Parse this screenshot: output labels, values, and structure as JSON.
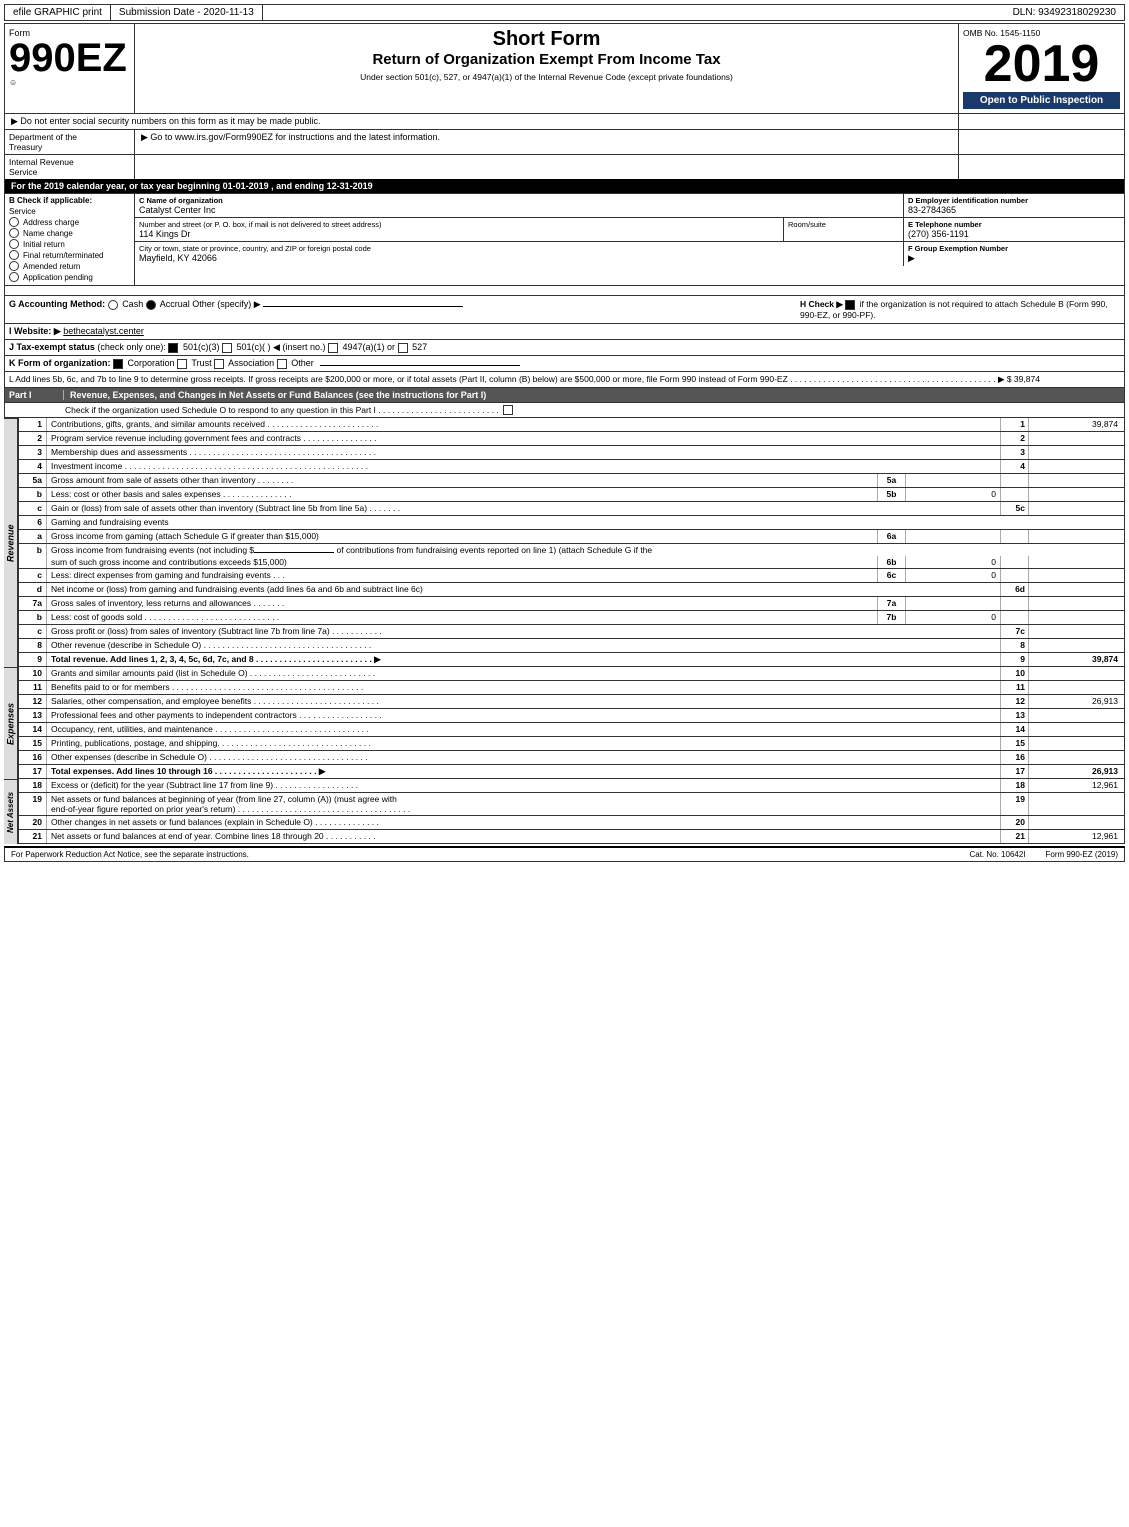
{
  "topBar": {
    "left": "efile GRAPHIC print",
    "mid": "Submission Date - 2020-11-13",
    "right": "DLN: 93492318029230"
  },
  "form": {
    "number": "990EZ",
    "numberSub": "Form",
    "shortFormLabel": "Short Form",
    "returnTitle": "Return of Organization Exempt From Income Tax",
    "subtitle": "Under section 501(c), 527, or 4947(a)(1) of the Internal Revenue Code (except private foundations)",
    "doNotEnter": "▶ Do not enter social security numbers on this form as it may be made public.",
    "goTo": "▶ Go to www.irs.gov/Form990EZ for instructions and the latest information.",
    "ombNo": "OMB No. 1545-1150",
    "year": "2019",
    "openToPublic": "Open to Public Inspection"
  },
  "dept": {
    "line1": "Department of the",
    "line2": "Treasury",
    "line3": "Internal Revenue",
    "line4": "Service"
  },
  "taxYear": {
    "text": "For the 2019 calendar year, or tax year beginning 01-01-2019 , and ending 12-31-2019"
  },
  "checkApplicable": {
    "label": "B Check if applicable:",
    "items": [
      "Address change",
      "Name change",
      "Initial return",
      "Final return/terminated",
      "Amended return",
      "Application pending"
    ]
  },
  "org": {
    "cLabel": "C Name of organization",
    "cValue": "Catalyst Center Inc",
    "dLabel": "D Employer identification number",
    "dValue": "83-2784365",
    "streetLabel": "Number and street (or P. O. box, if mail is not delivered to street address)",
    "streetValue": "114 Kings Dr",
    "roomLabel": "Room/suite",
    "roomValue": "",
    "phoneLabel": "E Telephone number",
    "phoneValue": "(270) 356-1191",
    "cityLabel": "City or town, state or province, country, and ZIP or foreign postal code",
    "cityValue": "Mayfield, KY  42066",
    "groupLabel": "F Group Exemption Number",
    "groupValue": "▶"
  },
  "accounting": {
    "gLabel": "G Accounting Method:",
    "cash": "Cash",
    "accrual": "Accrual",
    "other": "Other (specify) ▶",
    "accrualChecked": true,
    "hLabel": "H Check ▶",
    "hText": "if the organization is not required to attach Schedule B (Form 990, 990-EZ, or 990-PF).",
    "hChecked": true
  },
  "website": {
    "label": "I Website: ▶",
    "value": "bethecatalyst.center"
  },
  "taxStatus": {
    "label": "J Tax-exempt status (check only one):",
    "options": [
      "501(c)(3)",
      "501(c)(  )",
      "(insert no.)",
      "4947(a)(1) or",
      "527"
    ],
    "checked": "501(c)(3)"
  },
  "formOrg": {
    "label": "K Form of organization:",
    "options": [
      "Corporation",
      "Trust",
      "Association",
      "Other"
    ],
    "checked": "Corporation"
  },
  "lineL": {
    "text": "L Add lines 5b, 6c, and 7b to line 9 to determine gross receipts. If gross receipts are $200,000 or more, or if total assets (Part II, column (B) below) are $500,000 or more, file Form 990 instead of Form 990-EZ . . . . . . . . . . . . . . . . . . . . . . . . . . . . . . . . . . . . . . . . . . . . ▶ $ 39,874"
  },
  "partI": {
    "label": "Part I",
    "title": "Revenue, Expenses, and Changes in Net Assets or Fund Balances (see the instructions for Part I)",
    "checkScheduleO": "Check if the organization used Schedule O to respond to any question in this Part I . . . . . . . . . . . . . . . . . . . . . . . . . .",
    "rows": [
      {
        "num": "1",
        "desc": "Contributions, gifts, grants, and similar amounts received . . . . . . . . . . . . . . . . . . . . . . . .",
        "lineRef": "1",
        "amount": "39,874"
      },
      {
        "num": "2",
        "desc": "Program service revenue including government fees and contracts . . . . . . . . . . . . . . . .",
        "lineRef": "2",
        "amount": ""
      },
      {
        "num": "3",
        "desc": "Membership dues and assessments . . . . . . . . . . . . . . . . . . . . . . . . . . . . . . . . . . . . . . . .",
        "lineRef": "3",
        "amount": ""
      },
      {
        "num": "4",
        "desc": "Investment income . . . . . . . . . . . . . . . . . . . . . . . . . . . . . . . . . . . . . . . . . . . . . . . . . . . .",
        "lineRef": "4",
        "amount": ""
      }
    ],
    "row5a": {
      "num": "5a",
      "desc": "Gross amount from sale of assets other than inventory . . . . . . . .",
      "boxLabel": "5a",
      "boxVal": ""
    },
    "row5b": {
      "num": "b",
      "desc": "Less: cost or other basis and sales expenses . . . . . . . . . . . . . . .",
      "boxLabel": "5b",
      "boxVal": "0"
    },
    "row5c": {
      "num": "c",
      "desc": "Gain or (loss) from sale of assets other than inventory (Subtract line 5b from line 5a) . . . . . . .",
      "lineRef": "5c",
      "amount": ""
    },
    "row6header": {
      "num": "6",
      "desc": "Gaming and fundraising events"
    },
    "row6a": {
      "num": "a",
      "desc": "Gross income from gaming (attach Schedule G if greater than $15,000)",
      "boxLabel": "6a",
      "boxVal": ""
    },
    "row6b_desc": "Gross income from fundraising events (not including $",
    "row6b_desc2": "of contributions from fundraising events reported on line 1) (attach Schedule G if the sum of such gross income and contributions exceeds $15,000)",
    "row6b": {
      "num": "b",
      "boxLabel": "6b",
      "boxVal": "0"
    },
    "row6c": {
      "num": "c",
      "desc": "Less: direct expenses from gaming and fundraising events   .   .   .",
      "boxLabel": "6c",
      "boxVal": "0"
    },
    "row6d": {
      "num": "d",
      "desc": "Net income or (loss) from gaming and fundraising events (add lines 6a and 6b and subtract line 6c)",
      "lineRef": "6d",
      "amount": ""
    },
    "row7a": {
      "num": "7a",
      "desc": "Gross sales of inventory, less returns and allowances . . . . . . .",
      "boxLabel": "7a",
      "boxVal": ""
    },
    "row7b": {
      "num": "b",
      "desc": "Less: cost of goods sold        .   .   .   .   .   .   .   .   .   .   .   .   .   .   .   .   .   .   .   .   .   .   .   .   .   .   .   .   .   .",
      "boxLabel": "7b",
      "boxVal": "0"
    },
    "row7c": {
      "num": "c",
      "desc": "Gross profit or (loss) from sales of inventory (Subtract line 7b from line 7a) . . . . . . . . . . .",
      "lineRef": "7c",
      "amount": ""
    },
    "row8": {
      "num": "8",
      "desc": "Other revenue (describe in Schedule O) . . . . . . . . . . . . . . . . . . . . . . . . . . . . . . . . . . . .",
      "lineRef": "8",
      "amount": ""
    },
    "row9": {
      "num": "9",
      "desc": "Total revenue. Add lines 1, 2, 3, 4, 5c, 6d, 7c, and 8  . . . . . . . . . . . . . . . . . . . . . . . . . ▶",
      "lineRef": "9",
      "amount": "39,874",
      "bold": true
    }
  },
  "expenses": {
    "rows": [
      {
        "num": "10",
        "desc": "Grants and similar amounts paid (list in Schedule O) . . . . . . . . . . . . . . . . . . . . . . . . . . .",
        "lineRef": "10",
        "amount": ""
      },
      {
        "num": "11",
        "desc": "Benefits paid to or for members  . . . . . . . . . . . . . . . . . . . . . . . . . . . . . . . . . . . . . . . . .",
        "lineRef": "11",
        "amount": ""
      },
      {
        "num": "12",
        "desc": "Salaries, other compensation, and employee benefits . . . . . . . . . . . . . . . . . . . . . . . . . . .",
        "lineRef": "12",
        "amount": "26,913"
      },
      {
        "num": "13",
        "desc": "Professional fees and other payments to independent contractors . . . . . . . . . . . . . . . . . .",
        "lineRef": "13",
        "amount": ""
      },
      {
        "num": "14",
        "desc": "Occupancy, rent, utilities, and maintenance . . . . . . . . . . . . . . . . . . . . . . . . . . . . . . . . .",
        "lineRef": "14",
        "amount": ""
      },
      {
        "num": "15",
        "desc": "Printing, publications, postage, and shipping. . . . . . . . . . . . . . . . . . . . . . . . . . . . . . . . .",
        "lineRef": "15",
        "amount": ""
      },
      {
        "num": "16",
        "desc": "Other expenses (describe in Schedule O)  . . . . . . . . . . . . . . . . . . . . . . . . . . . . . . . . . .",
        "lineRef": "16",
        "amount": ""
      },
      {
        "num": "17",
        "desc": "Total expenses. Add lines 10 through 16     .   .   .   .   .   .   .   .   .   .   .   .   .   .   .   .   .   .   .   .   .   . ▶",
        "lineRef": "17",
        "amount": "26,913",
        "bold": true
      }
    ]
  },
  "netAssets": {
    "rows": [
      {
        "num": "18",
        "desc": "Excess or (deficit) for the year (Subtract line 17 from line 9)     .   .   .   .   .   .   .   .   .   .   .   .   .   .   .   .   .   .",
        "lineRef": "18",
        "amount": "12,961"
      },
      {
        "num": "19",
        "desc": "Net assets or fund balances at beginning of year (from line 27, column (A)) (must agree with end-of-year figure reported on prior year's return) . . . . . . . . . . . . . . . . . . . . . . . . . . . . . . . . . . . . .",
        "lineRef": "19",
        "amount": ""
      },
      {
        "num": "20",
        "desc": "Other changes in net assets or fund balances (explain in Schedule O) . . . . . . . . . . . . . .",
        "lineRef": "20",
        "amount": ""
      },
      {
        "num": "21",
        "desc": "Net assets or fund balances at end of year. Combine lines 18 through 20 . . . . . . . . . . .",
        "lineRef": "21",
        "amount": "12,961"
      }
    ]
  },
  "footer": {
    "left": "For Paperwork Reduction Act Notice, see the separate instructions.",
    "catNo": "Cat. No. 10642I",
    "right": "Form 990-EZ (2019)"
  }
}
